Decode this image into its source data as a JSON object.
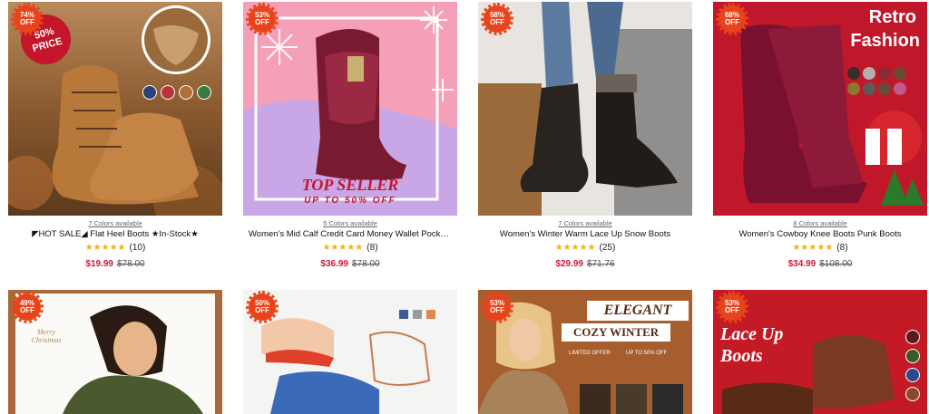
{
  "products": [
    {
      "badge_pct": "74%",
      "badge_off": "OFF",
      "colors_available": "7 Colors available",
      "title": "◤HOT SALE◢ Flat Heel Boots ★In-Stock★",
      "rating": 5,
      "reviews": "(10)",
      "price": "$19.99",
      "original": "$78.00",
      "promo": "50% PRICE",
      "swatches": [
        "#2e3f7a",
        "#b8323a",
        "#b0703e",
        "#3a7a3e"
      ]
    },
    {
      "badge_pct": "53%",
      "badge_off": "OFF",
      "colors_available": "5 Colors available",
      "title": "Women's Mid Calf Credit Card Money Wallet Pocket...",
      "rating": 5,
      "reviews": "(8)",
      "price": "$36.99",
      "original": "$78.00",
      "promo_title": "TOP SELLER",
      "promo_sub": "UP TO 50% OFF"
    },
    {
      "badge_pct": "58%",
      "badge_off": "OFF",
      "colors_available": "7 Colors available",
      "title": "Women's Winter Warm Lace Up Snow Boots",
      "rating": 5,
      "reviews": "(25)",
      "price": "$29.99",
      "original": "$71.76"
    },
    {
      "badge_pct": "68%",
      "badge_off": "OFF",
      "colors_available": "8 Colors available",
      "title": "Women's Cowboy Knee Boots Punk Boots",
      "rating": 5,
      "reviews": "(8)",
      "price": "$34.99",
      "original": "$108.00",
      "promo_title_1": "Retro",
      "promo_title_2": "Fashion",
      "swatches": [
        "#3a2c28",
        "#b4b0ad",
        "#8a2a36",
        "#6b4a30",
        "#8a7a2e",
        "#5c5a54",
        "#6a4a3a",
        "#c05a8a"
      ]
    },
    {
      "badge_pct": "49%",
      "badge_off": "OFF",
      "promo": "Merry Christmas"
    },
    {
      "badge_pct": "50%",
      "badge_off": "OFF",
      "swatches": [
        "#3a5a9a",
        "#9a9a9a",
        "#e08850"
      ]
    },
    {
      "badge_pct": "53%",
      "badge_off": "OFF",
      "promo_title": "ELEGANT",
      "promo_sub": "COZY WINTER",
      "promo_note_1": "LIMITED OFFER",
      "promo_note_2": "UP TO 50% OFF"
    },
    {
      "badge_pct": "53%",
      "badge_off": "OFF",
      "promo_title_1": "Lace Up",
      "promo_title_2": "Boots",
      "swatches": [
        "#5a1a1a",
        "#3a5a2a",
        "#2a4a8a",
        "#8a4a2a"
      ]
    }
  ]
}
